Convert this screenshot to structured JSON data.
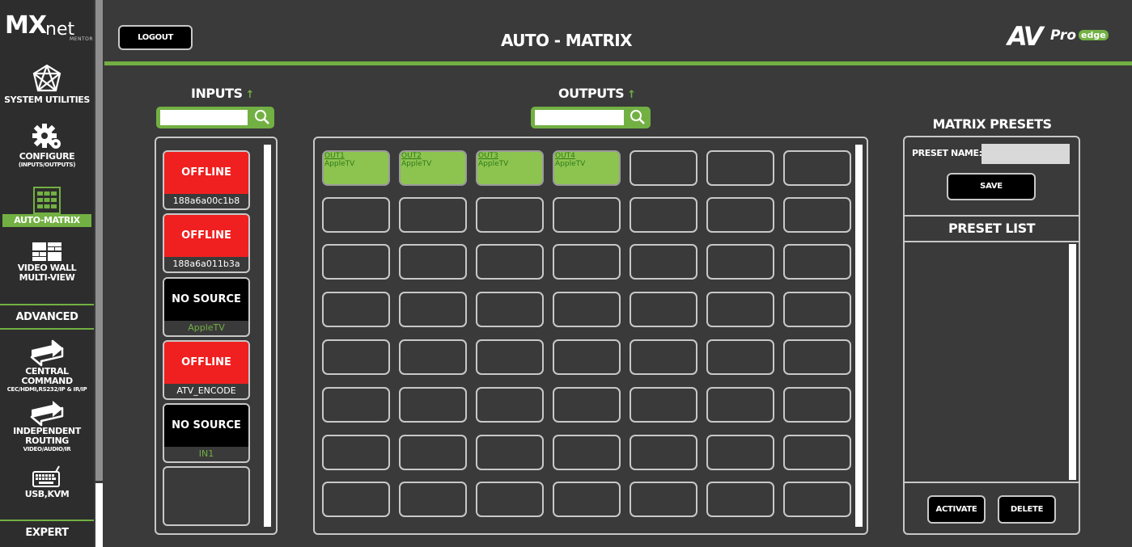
{
  "app": {
    "logo_main": "MX",
    "logo_sub": "net",
    "logo_tag": "MENTOR",
    "brand_av": "AV",
    "brand_pro": "Pro",
    "brand_edge": "edge"
  },
  "sidebar": {
    "system_utilities": "SYSTEM UTILITIES",
    "configure": "CONFIGURE",
    "configure_sub": "(INPUTS/OUTPUTS)",
    "auto_matrix": "AUTO-MATRIX",
    "video_wall": "VIDEO WALL",
    "multi_view": "MULTI-VIEW",
    "advanced": "ADVANCED",
    "central_command": "CENTRAL COMMAND",
    "central_command_sub": "CEC/HDMI,RS232/IP & IR/IP",
    "independent_routing": "INDEPENDENT ROUTING",
    "independent_routing_sub": "VIDEO/AUDIO/IR",
    "usb_kvm": "USB,KVM",
    "expert": "EXPERT"
  },
  "header": {
    "logout": "LOGOUT",
    "title": "AUTO - MATRIX"
  },
  "inputs": {
    "title": "INPUTS",
    "arrow": "↑",
    "search_value": "",
    "items": [
      {
        "state": "OFFLINE",
        "name": "188a6a00c1b8",
        "kind": "offline"
      },
      {
        "state": "OFFLINE",
        "name": "188a6a011b3a",
        "kind": "offline"
      },
      {
        "state": "NO SOURCE",
        "name": "AppleTV",
        "kind": "nosource"
      },
      {
        "state": "OFFLINE",
        "name": "ATV_ENCODE",
        "kind": "offline"
      },
      {
        "state": "NO SOURCE",
        "name": "IN1",
        "kind": "nosource"
      }
    ]
  },
  "outputs": {
    "title": "OUTPUTS",
    "arrow": "↑",
    "search_value": "",
    "items": [
      {
        "name": "OUT1",
        "source": "AppleTV"
      },
      {
        "name": "OUT2",
        "source": "AppleTV"
      },
      {
        "name": "OUT3",
        "source": "AppleTV"
      },
      {
        "name": "OUT4",
        "source": "AppleTV"
      }
    ]
  },
  "presets": {
    "title": "MATRIX PRESETS",
    "name_label": "PRESET NAME:",
    "name_value": "",
    "save": "SAVE",
    "list_title": "PRESET LIST",
    "activate": "ACTIVATE",
    "delete": "DELETE"
  },
  "colors": {
    "accent": "#72b043",
    "offline": "#f02020",
    "background": "#3a3a3a",
    "tile_active": "#8dc44f"
  }
}
